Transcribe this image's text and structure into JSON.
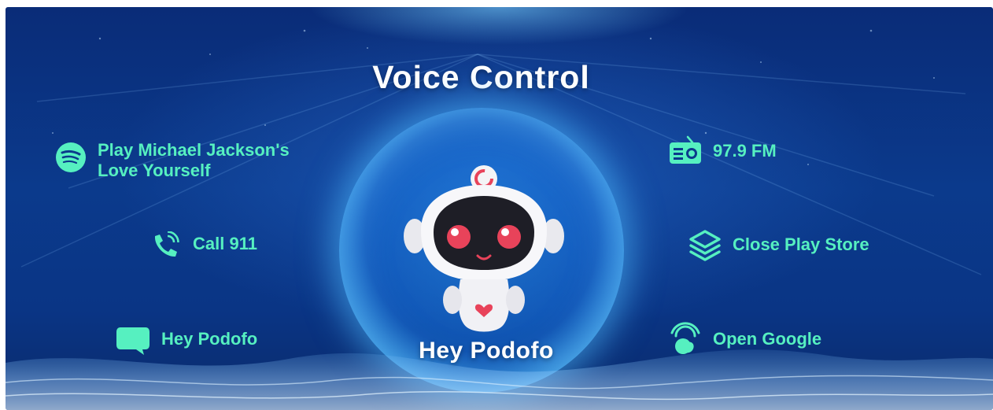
{
  "title": "Voice Control",
  "wake_word": "Hey Podofo",
  "colors": {
    "accent": "#56f0c0",
    "background": "#0b3a8c",
    "orb_glow": "#6ac8ff",
    "robot_eye": "#e8435a"
  },
  "commands": [
    {
      "id": "spotify",
      "icon": "spotify-icon",
      "lines": [
        "Play Michael Jackson's",
        "Love Yourself"
      ]
    },
    {
      "id": "call",
      "icon": "phone-call-icon",
      "lines": [
        "Call 911"
      ]
    },
    {
      "id": "hey",
      "icon": "chat-bubble-icon",
      "lines": [
        "Hey Podofo"
      ]
    },
    {
      "id": "radio",
      "icon": "radio-icon",
      "lines": [
        "97.9 FM"
      ]
    },
    {
      "id": "playstore",
      "icon": "layers-icon",
      "lines": [
        "Close Play Store"
      ]
    },
    {
      "id": "google",
      "icon": "google-assistant-icon",
      "lines": [
        "Open Google"
      ]
    }
  ]
}
